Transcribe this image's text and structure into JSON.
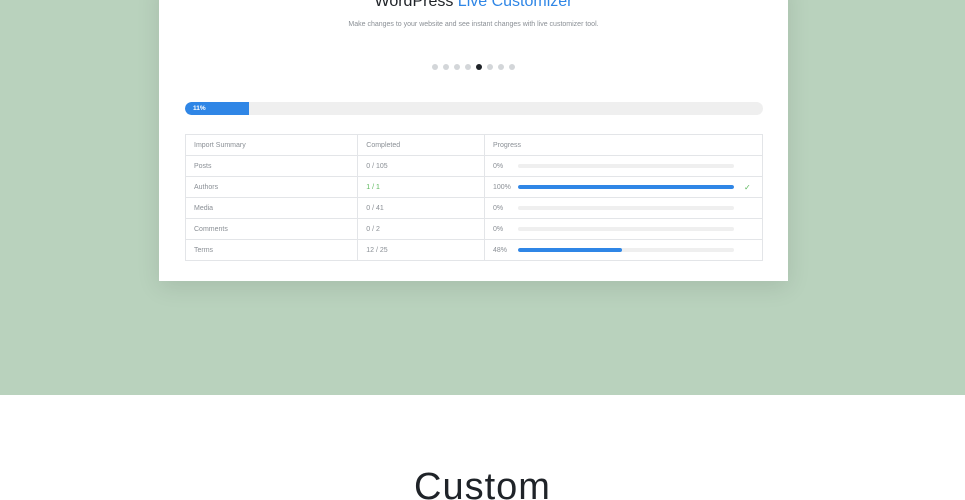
{
  "card": {
    "title_prefix": "WordPress",
    "title_accent": "Live Customizer",
    "subtitle": "Make changes to your website and see instant changes with live customizer tool.",
    "slider_dots": 8,
    "active_dot": 5
  },
  "overall_progress": {
    "label": "11%",
    "value": 0.11
  },
  "table": {
    "headers": [
      "Import Summary",
      "Completed",
      "Progress"
    ],
    "rows": [
      {
        "item": "Posts",
        "completed": "0 / 105",
        "progress_label": "0%",
        "progress": 0,
        "complete": false
      },
      {
        "item": "Authors",
        "completed": "1 / 1",
        "progress_label": "100%",
        "progress": 1,
        "complete": true
      },
      {
        "item": "Media",
        "completed": "0 / 41",
        "progress_label": "0%",
        "progress": 0,
        "complete": false
      },
      {
        "item": "Comments",
        "completed": "0 / 2",
        "progress_label": "0%",
        "progress": 0,
        "complete": false
      },
      {
        "item": "Terms",
        "completed": "12 / 25",
        "progress_label": "48%",
        "progress": 0.48,
        "complete": false
      }
    ]
  },
  "section": {
    "title": "Custom"
  },
  "colors": {
    "accent": "#2f86e6",
    "success": "#5cb85c",
    "hero_bg": "#b9d2bd"
  },
  "icons": {
    "complete": "check-icon"
  }
}
